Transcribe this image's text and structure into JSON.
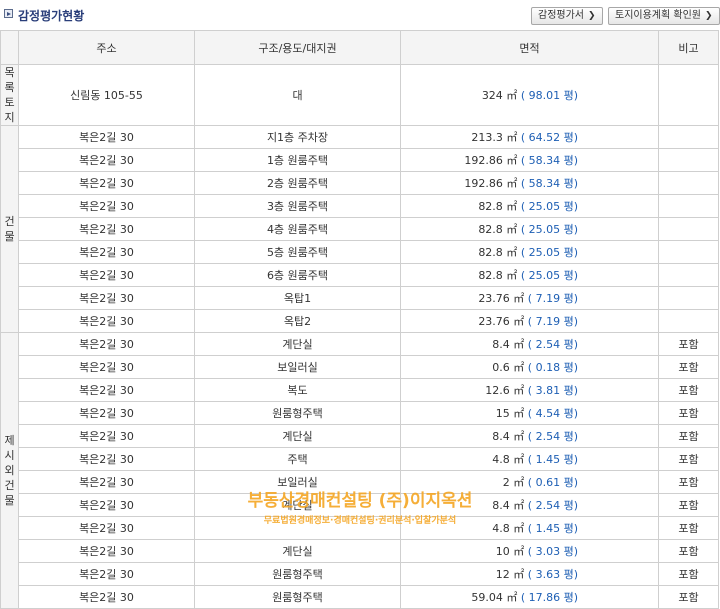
{
  "header": {
    "title": "감정평가현황",
    "buttons": [
      {
        "label": "감정평가서"
      },
      {
        "label": "토지이용계획 확인원"
      }
    ]
  },
  "columns": [
    "주소",
    "구조/용도/대지권",
    "면적",
    "비고"
  ],
  "categories": [
    {
      "label": "목\n록\n토\n지",
      "rows": [
        {
          "addr": "신림동 105-55",
          "use": "대",
          "area": "324 ㎡",
          "pyeong": "( 98.01 평)",
          "note": ""
        }
      ]
    },
    {
      "label": "건\n물",
      "rows": [
        {
          "addr": "복은2길 30",
          "use": "지1층 주차장",
          "area": "213.3 ㎡",
          "pyeong": "( 64.52 평)",
          "note": ""
        },
        {
          "addr": "복은2길 30",
          "use": "1층 원룸주택",
          "area": "192.86 ㎡",
          "pyeong": "( 58.34 평)",
          "note": ""
        },
        {
          "addr": "복은2길 30",
          "use": "2층 원룸주택",
          "area": "192.86 ㎡",
          "pyeong": "( 58.34 평)",
          "note": ""
        },
        {
          "addr": "복은2길 30",
          "use": "3층 원룸주택",
          "area": "82.8 ㎡",
          "pyeong": "( 25.05 평)",
          "note": ""
        },
        {
          "addr": "복은2길 30",
          "use": "4층 원룸주택",
          "area": "82.8 ㎡",
          "pyeong": "( 25.05 평)",
          "note": ""
        },
        {
          "addr": "복은2길 30",
          "use": "5층 원룸주택",
          "area": "82.8 ㎡",
          "pyeong": "( 25.05 평)",
          "note": ""
        },
        {
          "addr": "복은2길 30",
          "use": "6층 원룸주택",
          "area": "82.8 ㎡",
          "pyeong": "( 25.05 평)",
          "note": ""
        },
        {
          "addr": "복은2길 30",
          "use": "옥탑1",
          "area": "23.76 ㎡",
          "pyeong": "( 7.19 평)",
          "note": ""
        },
        {
          "addr": "복은2길 30",
          "use": "옥탑2",
          "area": "23.76 ㎡",
          "pyeong": "( 7.19 평)",
          "note": ""
        }
      ]
    },
    {
      "label": "제\n시\n외\n건\n물",
      "rows": [
        {
          "addr": "복은2길 30",
          "use": "계단실",
          "area": "8.4 ㎡",
          "pyeong": "( 2.54 평)",
          "note": "포함"
        },
        {
          "addr": "복은2길 30",
          "use": "보일러실",
          "area": "0.6 ㎡",
          "pyeong": "( 0.18 평)",
          "note": "포함"
        },
        {
          "addr": "복은2길 30",
          "use": "복도",
          "area": "12.6 ㎡",
          "pyeong": "( 3.81 평)",
          "note": "포함"
        },
        {
          "addr": "복은2길 30",
          "use": "원룸형주택",
          "area": "15 ㎡",
          "pyeong": "( 4.54 평)",
          "note": "포함"
        },
        {
          "addr": "복은2길 30",
          "use": "계단실",
          "area": "8.4 ㎡",
          "pyeong": "( 2.54 평)",
          "note": "포함"
        },
        {
          "addr": "복은2길 30",
          "use": "주택",
          "area": "4.8 ㎡",
          "pyeong": "( 1.45 평)",
          "note": "포함"
        },
        {
          "addr": "복은2길 30",
          "use": "보일러실",
          "area": "2 ㎡",
          "pyeong": "( 0.61 평)",
          "note": "포함"
        },
        {
          "addr": "복은2길 30",
          "use": "계단실",
          "area": "8.4 ㎡",
          "pyeong": "( 2.54 평)",
          "note": "포함"
        },
        {
          "addr": "복은2길 30",
          "use": "",
          "area": "4.8 ㎡",
          "pyeong": "( 1.45 평)",
          "note": "포함"
        },
        {
          "addr": "복은2길 30",
          "use": "계단실",
          "area": "10 ㎡",
          "pyeong": "( 3.03 평)",
          "note": "포함"
        },
        {
          "addr": "복은2길 30",
          "use": "원룸형주택",
          "area": "12 ㎡",
          "pyeong": "( 3.63 평)",
          "note": "포함"
        },
        {
          "addr": "복은2길 30",
          "use": "원룸형주택",
          "area": "59.04 ㎡",
          "pyeong": "( 17.86 평)",
          "note": "포함"
        }
      ]
    }
  ],
  "watermark": {
    "line1": "부동산경매컨설팅 (주)이지옥션",
    "line2": "무료법원경매정보·경매컨설팅·권리분석·입찰가분석"
  },
  "colors": {
    "title": "#2a3e7a",
    "pyeong": "#1e5fb4",
    "watermark": "#f5a623"
  }
}
